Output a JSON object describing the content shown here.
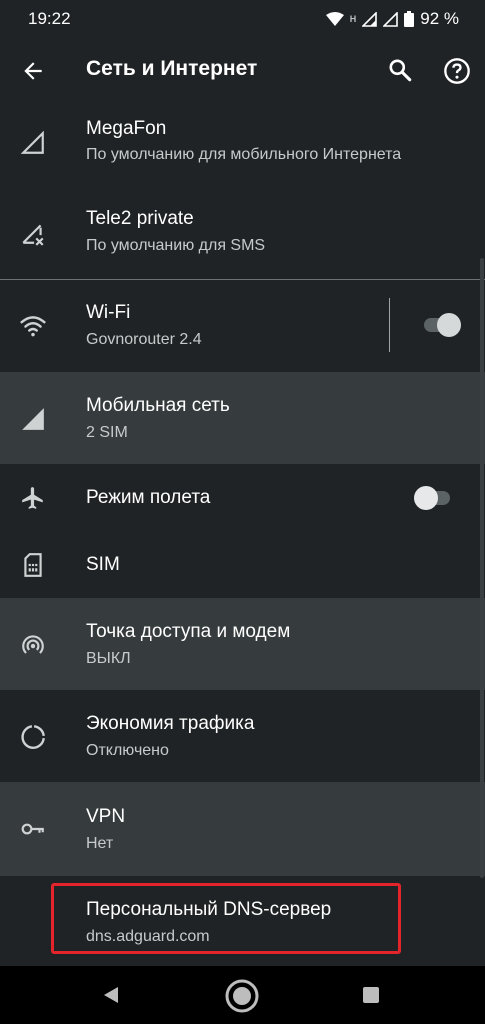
{
  "status": {
    "time": "19:22",
    "network_badge": "H",
    "battery": "92 %"
  },
  "toolbar": {
    "title": "Сеть и Интернет",
    "back_icon": "arrow-back-icon",
    "search_icon": "search-icon",
    "help_icon": "help-icon"
  },
  "sims": [
    {
      "title": "MegaFon",
      "subtitle": "По умолчанию для мобильного Интернета",
      "icon": "signal-outline-icon"
    },
    {
      "title": "Tele2 private",
      "subtitle": "По умолчанию для SMS",
      "icon": "signal-off-icon"
    }
  ],
  "settings": {
    "wifi": {
      "title": "Wi-Fi",
      "subtitle": "Govnorouter 2.4",
      "toggle_on": true
    },
    "mobile": {
      "title": "Мобильная сеть",
      "subtitle": "2 SIM"
    },
    "airplane": {
      "title": "Режим полета",
      "toggle_on": false
    },
    "sim": {
      "title": "SIM"
    },
    "hotspot": {
      "title": "Точка доступа и модем",
      "subtitle": "ВЫКЛ"
    },
    "datasaver": {
      "title": "Экономия трафика",
      "subtitle": "Отключено"
    },
    "vpn": {
      "title": "VPN",
      "subtitle": "Нет"
    },
    "dns": {
      "title": "Персональный DNS-сервер",
      "subtitle": "dns.adguard.com"
    }
  },
  "colors": {
    "background": "#1f2325",
    "highlight_row": "#363b3d",
    "annotation_box": "#e3242b"
  }
}
